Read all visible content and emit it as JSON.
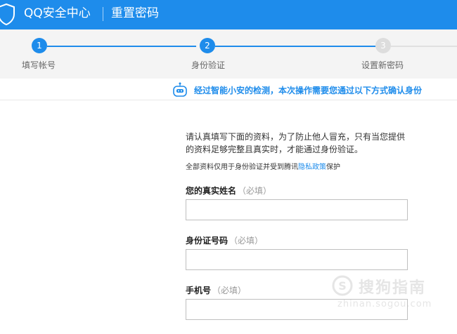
{
  "header": {
    "app_title": "QQ安全中心",
    "page_title": "重置密码",
    "colors": {
      "accent": "#1e8ceb",
      "inactive": "#dddddd"
    }
  },
  "steps": [
    {
      "number": "1",
      "label": "填写帐号",
      "state": "done"
    },
    {
      "number": "2",
      "label": "身份验证",
      "state": "active"
    },
    {
      "number": "3",
      "label": "设置新密码",
      "state": "pending"
    }
  ],
  "notice": {
    "icon": "robot-icon",
    "text": "经过智能小安的检测，本次操作需要您通过以下方式确认身份"
  },
  "form": {
    "description": "请认真填写下面的资料，为了防止他人冒充，只有当您提供的资料足够完整且真实时，才能通过身份验证。",
    "privacy_prefix": "全部资料仅用于身份验证并受到腾讯",
    "privacy_link": "隐私政策",
    "privacy_suffix": "保护",
    "fields": [
      {
        "label": "您的真实姓名",
        "hint": "（必填）",
        "value": ""
      },
      {
        "label": "身份证号码",
        "hint": "（必填）",
        "value": ""
      },
      {
        "label": "手机号",
        "hint": "（必填）",
        "value": ""
      }
    ]
  },
  "watermark": {
    "title": "搜狗指南",
    "url": "zhinan.sogou.com"
  }
}
